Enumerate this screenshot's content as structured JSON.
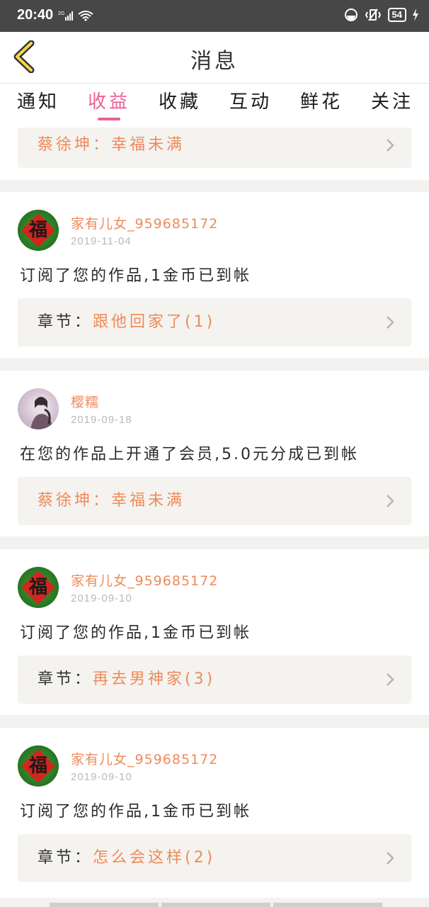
{
  "status_bar": {
    "time": "20:40",
    "network": "2G",
    "battery": "54"
  },
  "header": {
    "title": "消息"
  },
  "tabs": [
    {
      "label": "通知",
      "active": false
    },
    {
      "label": "收益",
      "active": true
    },
    {
      "label": "收藏",
      "active": false
    },
    {
      "label": "互动",
      "active": false
    },
    {
      "label": "鲜花",
      "active": false
    },
    {
      "label": "关注",
      "active": false
    }
  ],
  "partial_card": {
    "link": "蔡徐坤：幸福未满"
  },
  "messages": [
    {
      "username": "家有儿女_959685172",
      "date": "2019-11-04",
      "text": "订阅了您的作品,1金币已到帐",
      "link_label": "章节：",
      "link_value": "跟他回家了(1)",
      "avatar": "fu"
    },
    {
      "username": "樱糯",
      "date": "2019-09-18",
      "text": "在您的作品上开通了会员,5.0元分成已到帐",
      "link_label": "",
      "link_value": "蔡徐坤：幸福未满",
      "avatar": "photo"
    },
    {
      "username": "家有儿女_959685172",
      "date": "2019-09-10",
      "text": "订阅了您的作品,1金币已到帐",
      "link_label": "章节：",
      "link_value": "再去男神家(3)",
      "avatar": "fu"
    },
    {
      "username": "家有儿女_959685172",
      "date": "2019-09-10",
      "text": "订阅了您的作品,1金币已到帐",
      "link_label": "章节：",
      "link_value": "怎么会这样(2)",
      "avatar": "fu"
    }
  ],
  "fu_char": "福",
  "colors": {
    "accent": "#ee5f94",
    "username": "#ef8a5a",
    "status_bar": "#474747"
  }
}
